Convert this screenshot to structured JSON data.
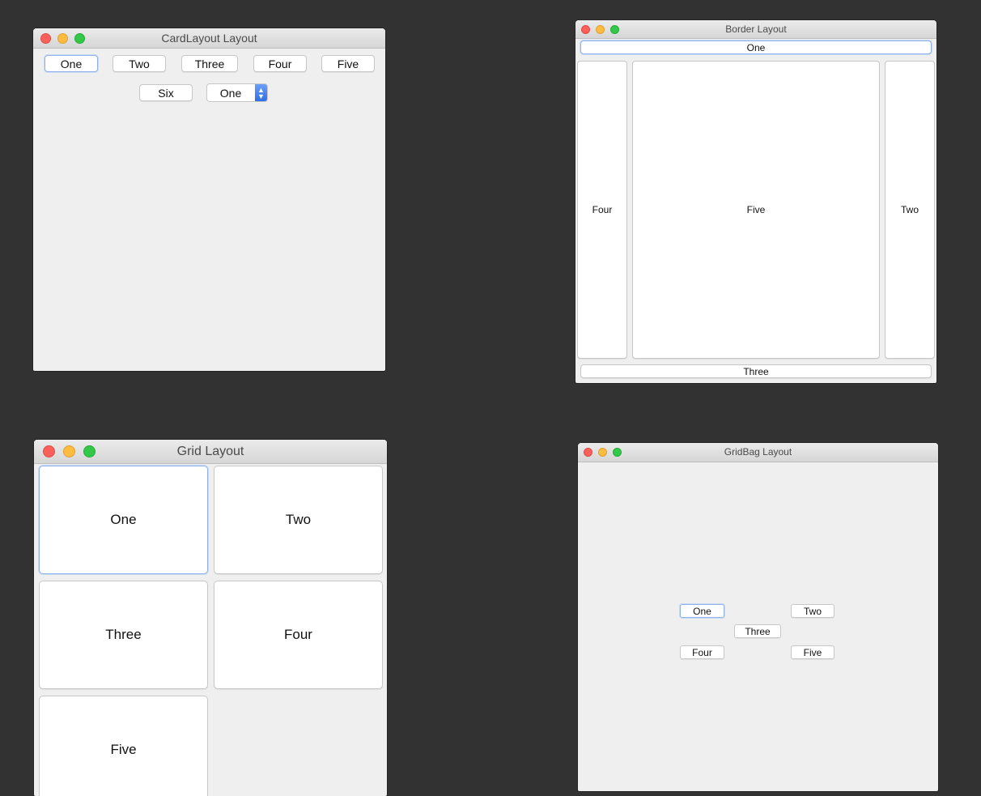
{
  "card_window": {
    "title": "CardLayout Layout",
    "buttons": [
      "One",
      "Two",
      "Three",
      "Four",
      "Five",
      "Six"
    ],
    "combo_value": "One"
  },
  "border_window": {
    "title": "Border Layout",
    "north": "One",
    "west": "Four",
    "center": "Five",
    "east": "Two",
    "south": "Three"
  },
  "grid_window": {
    "title": "Grid Layout",
    "buttons": [
      "One",
      "Two",
      "Three",
      "Four",
      "Five"
    ]
  },
  "gridbag_window": {
    "title": "GridBag Layout",
    "buttons": [
      "One",
      "Two",
      "Three",
      "Four",
      "Five"
    ]
  },
  "colors": {
    "desktop": "#323232",
    "window_bg": "#efefef",
    "close": "#fc605b",
    "minimize": "#fdbc40",
    "zoom": "#34c84a",
    "focus_ring": "#8fb2e8",
    "combo_accent": "#2f6ee6"
  }
}
